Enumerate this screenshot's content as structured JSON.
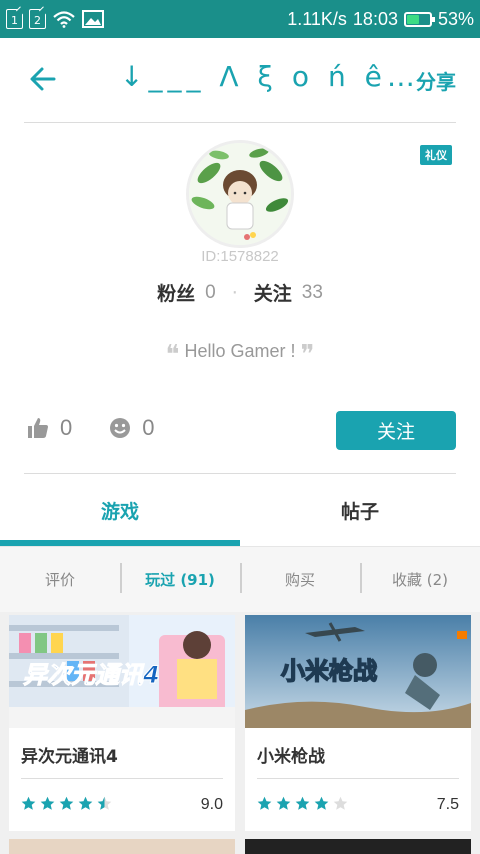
{
  "status_bar": {
    "sim1": "1",
    "sim2": "2",
    "speed": "1.11K/s",
    "time": "18:03",
    "battery": "53%"
  },
  "header": {
    "title": "↓___ Λ ξ ο ń ê…",
    "share": "分享"
  },
  "profile": {
    "badge": "礼仪",
    "user_id": "ID:1578822",
    "fans_label": "粉丝",
    "fans_count": "0",
    "following_label": "关注",
    "following_count": "33",
    "signature": "Hello Gamer !",
    "likes": "0",
    "emoji_count": "0",
    "follow_button": "关注"
  },
  "tabs": [
    {
      "label": "游戏",
      "active": true
    },
    {
      "label": "帖子",
      "active": false
    }
  ],
  "filters": [
    {
      "label": "评价"
    },
    {
      "label": "玩过 (91)"
    },
    {
      "label": "购买"
    },
    {
      "label": "收藏 (2)"
    }
  ],
  "games": [
    {
      "name": "异次元通讯4",
      "score": "9.0",
      "rating": 4.5,
      "thumb_text": "异次元通讯4"
    },
    {
      "name": "小米枪战",
      "score": "7.5",
      "rating": 4,
      "thumb_text": "小米枪战"
    }
  ],
  "colors": {
    "accent": "#1aa3b0",
    "status_bar": "#1a8f8a",
    "star": "#1aa3b0",
    "star_empty": "#dddddd"
  }
}
